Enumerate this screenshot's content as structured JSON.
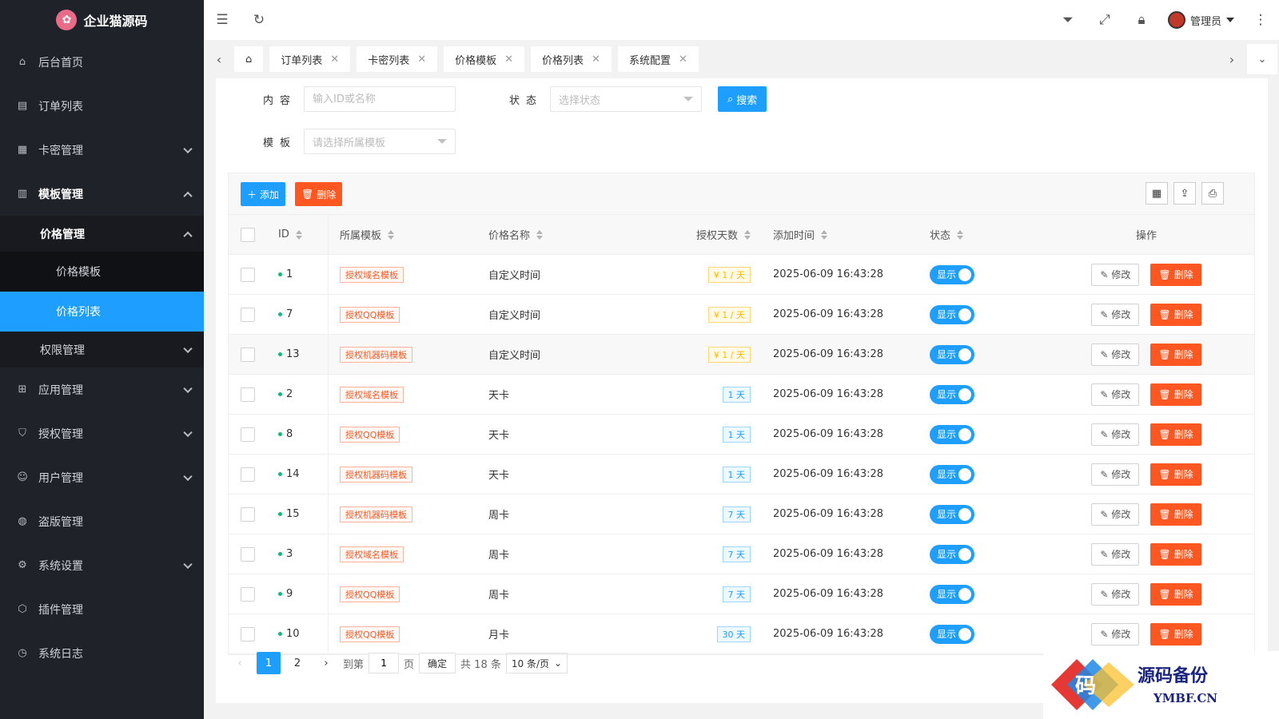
{
  "brand": {
    "name": "企业猫源码",
    "logo_color": "#e96b8a"
  },
  "sidebar": {
    "items": [
      {
        "label": "后台首页",
        "icon": "home-icon"
      },
      {
        "label": "订单列表",
        "icon": "document-icon"
      },
      {
        "label": "卡密管理",
        "icon": "grid-icon"
      },
      {
        "label": "模板管理",
        "icon": "template-icon"
      },
      {
        "label": "价格管理"
      },
      {
        "label": "价格模板"
      },
      {
        "label": "价格列表"
      },
      {
        "label": "权限管理"
      },
      {
        "label": "应用管理",
        "icon": "apps-icon"
      },
      {
        "label": "授权管理",
        "icon": "shield-icon"
      },
      {
        "label": "用户管理",
        "icon": "user-icon"
      },
      {
        "label": "盗版管理",
        "icon": "globe-icon"
      },
      {
        "label": "系统设置",
        "icon": "gear-icon"
      },
      {
        "label": "插件管理",
        "icon": "cube-icon"
      },
      {
        "label": "系统日志",
        "icon": "clock-icon"
      }
    ]
  },
  "header": {
    "admin_label": "管理员"
  },
  "tabs": [
    {
      "label": "订单列表"
    },
    {
      "label": "卡密列表"
    },
    {
      "label": "价格模板"
    },
    {
      "label": "价格列表"
    },
    {
      "label": "系统配置"
    }
  ],
  "search": {
    "content_label": "内容",
    "content_placeholder": "输入ID或名称",
    "status_label": "状态",
    "status_placeholder": "选择状态",
    "template_label": "模板",
    "template_placeholder": "请选择所属模板",
    "search_button": "搜索"
  },
  "toolbar": {
    "add_label": "添加",
    "delete_label": "删除"
  },
  "table": {
    "headers": {
      "id": "ID",
      "template": "所属模板",
      "name": "价格名称",
      "days": "授权天数",
      "time": "添加时间",
      "status": "状态",
      "ops": "操作"
    },
    "rows": [
      {
        "id": "1",
        "template": "授权域名模板",
        "name": "自定义时间",
        "days": "¥ 1 / 天",
        "days_style": "y",
        "time": "2025-06-09 16:43:28",
        "status": "显示"
      },
      {
        "id": "7",
        "template": "授权QQ模板",
        "name": "自定义时间",
        "days": "¥ 1 / 天",
        "days_style": "y",
        "time": "2025-06-09 16:43:28",
        "status": "显示"
      },
      {
        "id": "13",
        "template": "授权机器码模板",
        "name": "自定义时间",
        "days": "¥ 1 / 天",
        "days_style": "y",
        "time": "2025-06-09 16:43:28",
        "status": "显示"
      },
      {
        "id": "2",
        "template": "授权域名模板",
        "name": "天卡",
        "days": "1 天",
        "days_style": "b",
        "time": "2025-06-09 16:43:28",
        "status": "显示"
      },
      {
        "id": "8",
        "template": "授权QQ模板",
        "name": "天卡",
        "days": "1 天",
        "days_style": "b",
        "time": "2025-06-09 16:43:28",
        "status": "显示"
      },
      {
        "id": "14",
        "template": "授权机器码模板",
        "name": "天卡",
        "days": "1 天",
        "days_style": "b",
        "time": "2025-06-09 16:43:28",
        "status": "显示"
      },
      {
        "id": "15",
        "template": "授权机器码模板",
        "name": "周卡",
        "days": "7 天",
        "days_style": "b",
        "time": "2025-06-09 16:43:28",
        "status": "显示"
      },
      {
        "id": "3",
        "template": "授权域名模板",
        "name": "周卡",
        "days": "7 天",
        "days_style": "b",
        "time": "2025-06-09 16:43:28",
        "status": "显示"
      },
      {
        "id": "9",
        "template": "授权QQ模板",
        "name": "周卡",
        "days": "7 天",
        "days_style": "b",
        "time": "2025-06-09 16:43:28",
        "status": "显示"
      },
      {
        "id": "10",
        "template": "授权QQ模板",
        "name": "月卡",
        "days": "30 天",
        "days_style": "b",
        "time": "2025-06-09 16:43:28",
        "status": "显示"
      }
    ],
    "edit_label": "修改",
    "delete_label": "删除"
  },
  "pagination": {
    "page1": "1",
    "page2": "2",
    "goto_label": "到第",
    "goto_value": "1",
    "page_suffix": "页",
    "confirm": "确定",
    "total": "共 18 条",
    "per_page": "10 条/页"
  },
  "watermark": {
    "title": "源码备份",
    "site": "YMBF.CN",
    "glyph": "码"
  },
  "colors": {
    "primary": "#1e9fff",
    "danger": "#ff5722",
    "sidebar": "#20222a"
  }
}
